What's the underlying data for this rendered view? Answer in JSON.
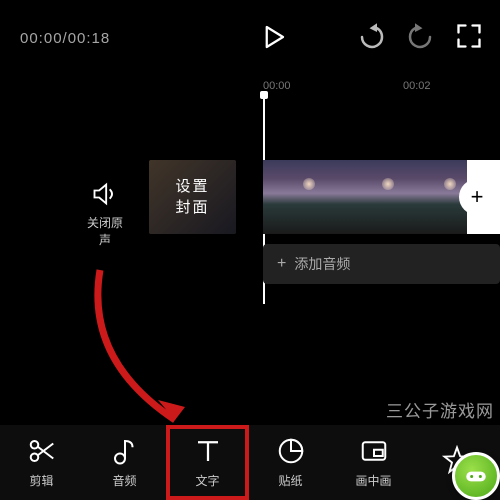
{
  "topbar": {
    "time_current": "00:00",
    "time_total": "00:18",
    "time_display": "00:00/00:18"
  },
  "ruler": {
    "tick1": "00:00",
    "tick2": "00:02"
  },
  "mute": {
    "label": "关闭原声"
  },
  "cover": {
    "label": "设置\n封面"
  },
  "audio": {
    "add_label": "添加音频",
    "plus": "+"
  },
  "add_clip": {
    "plus": "+"
  },
  "toolbar": {
    "items": [
      {
        "key": "cut",
        "label": "剪辑"
      },
      {
        "key": "audio",
        "label": "音频"
      },
      {
        "key": "text",
        "label": "文字"
      },
      {
        "key": "sticker",
        "label": "贴纸"
      },
      {
        "key": "pip",
        "label": "画中画"
      },
      {
        "key": "fx",
        "label": ""
      }
    ]
  },
  "watermark": "三公子游戏网",
  "annotation": {
    "highlight_index": 2,
    "arrow_target": "text-tool"
  }
}
